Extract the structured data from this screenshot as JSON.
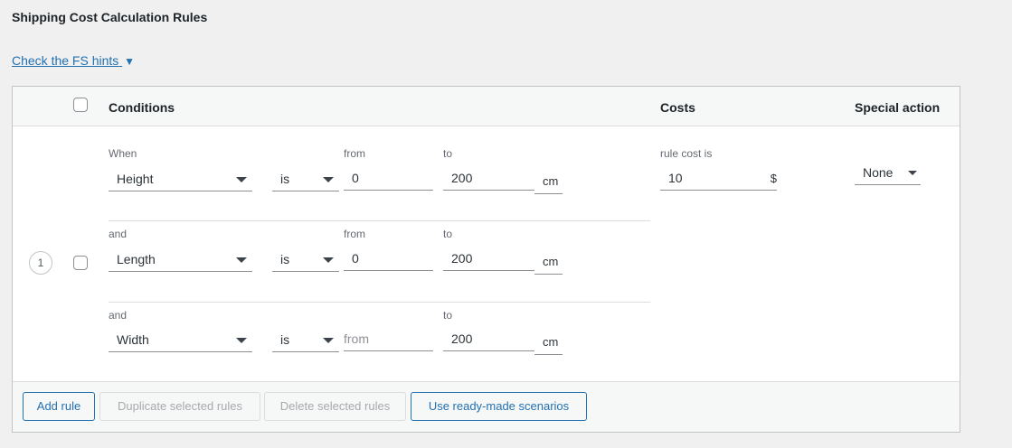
{
  "page": {
    "title": "Shipping Cost Calculation Rules"
  },
  "hints": {
    "link_text": "Check the FS hints",
    "toggle_glyph": "▼"
  },
  "table": {
    "headers": {
      "conditions": "Conditions",
      "costs": "Costs",
      "special_action": "Special action"
    },
    "rows": [
      {
        "number": "1",
        "conditions": [
          {
            "prefix": "When",
            "field": "Height",
            "operator": "is",
            "from_label": "from",
            "from_value": "0",
            "from_placeholder": "",
            "to_label": "to",
            "to_value": "200",
            "unit": "cm"
          },
          {
            "prefix": "and",
            "field": "Length",
            "operator": "is",
            "from_label": "from",
            "from_value": "0",
            "from_placeholder": "",
            "to_label": "to",
            "to_value": "200",
            "unit": "cm"
          },
          {
            "prefix": "and",
            "field": "Width",
            "operator": "is",
            "from_label": "",
            "from_value": "",
            "from_placeholder": "from",
            "to_label": "to",
            "to_value": "200",
            "unit": "cm"
          }
        ],
        "cost": {
          "label": "rule cost is",
          "value": "10",
          "currency": "$"
        },
        "special_action": "None"
      }
    ]
  },
  "footer": {
    "add_rule": "Add rule",
    "duplicate": "Duplicate selected rules",
    "delete": "Delete selected rules",
    "scenarios": "Use ready-made scenarios"
  },
  "colors": {
    "link": "#2271b1",
    "border": "#c3c4c7",
    "disabled": "#a7aaad"
  }
}
